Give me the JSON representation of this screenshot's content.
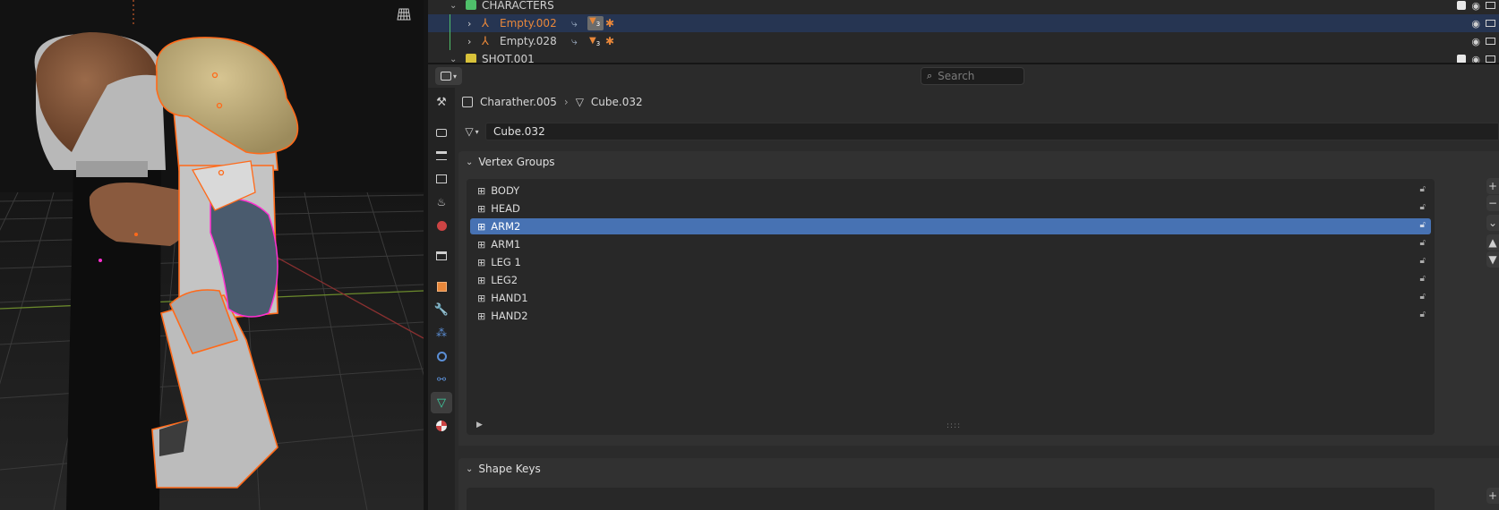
{
  "outliner": {
    "rows": [
      {
        "label": "CHARACTERS",
        "active": false,
        "selected": false
      },
      {
        "label": "Empty.002",
        "active": true,
        "selected": true
      },
      {
        "label": "Empty.028",
        "active": false,
        "selected": false
      },
      {
        "label": "SHOT.001",
        "active": false,
        "selected": false
      }
    ],
    "modifier_badge": "3"
  },
  "properties": {
    "search_placeholder": "Search",
    "breadcrumb": {
      "object": "Charather.005",
      "mesh": "Cube.032"
    },
    "mesh_name": "Cube.032",
    "vertex_groups": {
      "title": "Vertex Groups",
      "items": [
        "BODY",
        "HEAD",
        "ARM2",
        "ARM1",
        "LEG 1",
        "LEG2",
        "HAND1",
        "HAND2"
      ],
      "selected": "ARM2"
    },
    "shape_keys": {
      "title": "Shape Keys"
    }
  },
  "colors": {
    "selection": "#4772b3",
    "active_object": "#e8873a",
    "mesh_tab": "#3fd6a7"
  }
}
